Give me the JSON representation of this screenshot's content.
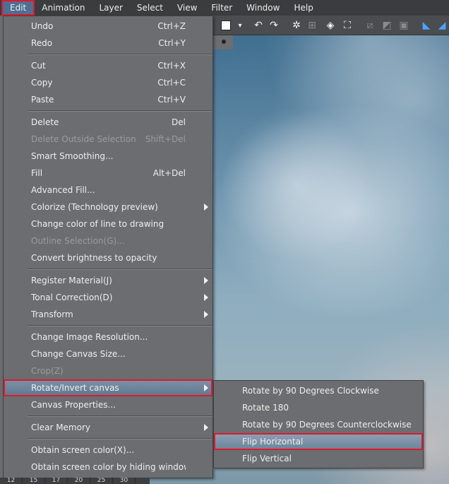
{
  "menubar": [
    {
      "label": "Edit",
      "active": true
    },
    {
      "label": "Animation"
    },
    {
      "label": "Layer"
    },
    {
      "label": "Select"
    },
    {
      "label": "View"
    },
    {
      "label": "Filter"
    },
    {
      "label": "Window"
    },
    {
      "label": "Help"
    }
  ],
  "edit_menu": {
    "undo": {
      "label": "Undo",
      "shortcut": "Ctrl+Z"
    },
    "redo": {
      "label": "Redo",
      "shortcut": "Ctrl+Y"
    },
    "cut": {
      "label": "Cut",
      "shortcut": "Ctrl+X"
    },
    "copy": {
      "label": "Copy",
      "shortcut": "Ctrl+C"
    },
    "paste": {
      "label": "Paste",
      "shortcut": "Ctrl+V"
    },
    "delete": {
      "label": "Delete",
      "shortcut": "Del"
    },
    "delete_outside": {
      "label": "Delete Outside Selection",
      "shortcut": "Shift+Del"
    },
    "smart_smoothing": {
      "label": "Smart Smoothing..."
    },
    "fill": {
      "label": "Fill",
      "shortcut": "Alt+Del"
    },
    "advanced_fill": {
      "label": "Advanced Fill..."
    },
    "colorize": {
      "label": "Colorize (Technology preview)"
    },
    "change_line_color": {
      "label": "Change color of line to drawing"
    },
    "outline_selection": {
      "label": "Outline Selection(G)..."
    },
    "brightness_opacity": {
      "label": "Convert brightness to opacity"
    },
    "register_material": {
      "label": "Register Material(J)"
    },
    "tonal_correction": {
      "label": "Tonal Correction(D)"
    },
    "transform": {
      "label": "Transform"
    },
    "image_resolution": {
      "label": "Change Image Resolution..."
    },
    "canvas_size": {
      "label": "Change Canvas Size..."
    },
    "crop": {
      "label": "Crop(Z)"
    },
    "rotate_invert": {
      "label": "Rotate/Invert canvas"
    },
    "canvas_properties": {
      "label": "Canvas Properties..."
    },
    "clear_memory": {
      "label": "Clear Memory"
    },
    "screen_color": {
      "label": "Obtain screen color(X)..."
    },
    "screen_color_hiding": {
      "label": "Obtain screen color by hiding windows..."
    }
  },
  "rotate_submenu": {
    "rot90cw": "Rotate by 90 Degrees Clockwise",
    "rot180": "Rotate 180",
    "rot90ccw": "Rotate by 90 Degrees Counterclockwise",
    "flip_h": "Flip Horizontal",
    "flip_v": "Flip Vertical"
  },
  "timeline": [
    "12",
    "15",
    "17",
    "20",
    "25",
    "30"
  ],
  "colors": {
    "highlight_outline": "#e0192b",
    "menu_bg": "#6b6d70",
    "menubar_bg": "#3a3c3e",
    "active_title": "#4f6e92"
  }
}
